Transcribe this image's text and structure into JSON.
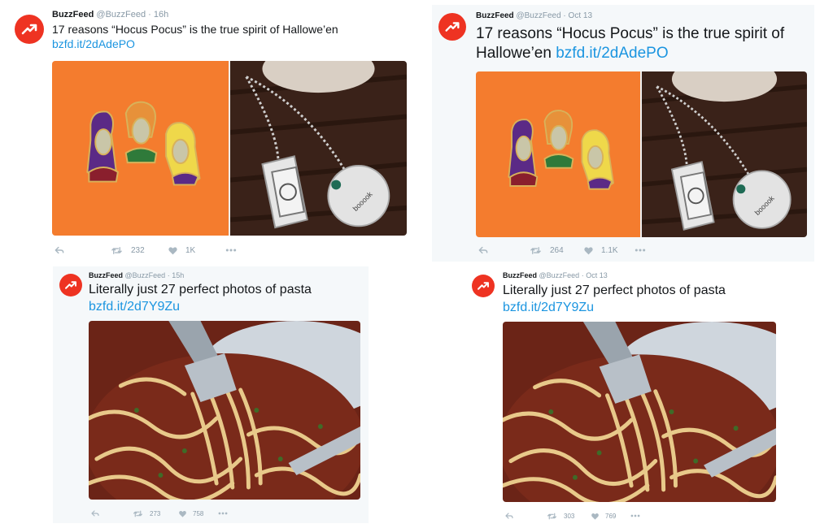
{
  "colors": {
    "brand": "#ee3322",
    "link": "#1b95e0",
    "muted": "#8899a6",
    "icon": "#aab8c2",
    "orange_bg": "#f47c2e",
    "wood_bg": "#3a2219",
    "pasta_sauce": "#7a2a1a"
  },
  "icons": {
    "avatar": "buzzfeed-trending-arrow",
    "reply": "reply-arrow",
    "retweet": "retweet-arrows",
    "like": "heart",
    "more": "ellipsis"
  },
  "tweets": [
    {
      "name": "BuzzFeed",
      "handle": "@BuzzFeed",
      "dot": "·",
      "time": "16h",
      "text": "17 reasons “Hocus Pocus” is the true spirit of Hallowe’en",
      "link": "bzfd.it/2dAdePO",
      "retweets": "232",
      "likes": "1K"
    },
    {
      "name": "BuzzFeed",
      "handle": "@BuzzFeed",
      "dot": "·",
      "time": "Oct 13",
      "text": "17 reasons “Hocus Pocus” is the true spirit of Hallowe’en",
      "link": "bzfd.it/2dAdePO",
      "retweets": "264",
      "likes": "1.1K"
    },
    {
      "name": "BuzzFeed",
      "handle": "@BuzzFeed",
      "dot": "·",
      "time": "15h",
      "text": "Literally just 27 perfect photos of pasta",
      "link": "bzfd.it/2d7Y9Zu",
      "retweets": "273",
      "likes": "758"
    },
    {
      "name": "BuzzFeed",
      "handle": "@BuzzFeed",
      "dot": "·",
      "time": "Oct 13",
      "text": "Literally just 27 perfect photos of pasta",
      "link": "bzfd.it/2d7Y9Zu",
      "retweets": "303",
      "likes": "769"
    }
  ],
  "images": {
    "pendant_text": "booook"
  }
}
